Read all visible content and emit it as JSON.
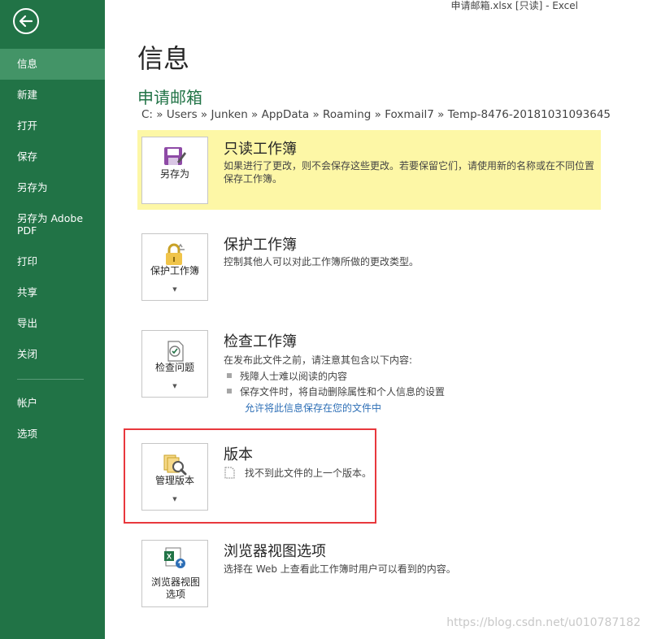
{
  "window": {
    "title": "申请邮箱.xlsx  [只读] - Excel"
  },
  "sidebar": {
    "items": [
      {
        "label": "信息",
        "active": true
      },
      {
        "label": "新建"
      },
      {
        "label": "打开"
      },
      {
        "label": "保存"
      },
      {
        "label": "另存为"
      },
      {
        "label": "另存为 Adobe PDF"
      },
      {
        "label": "打印"
      },
      {
        "label": "共享"
      },
      {
        "label": "导出"
      },
      {
        "label": "关闭"
      },
      {
        "label": "帐户"
      },
      {
        "label": "选项"
      }
    ]
  },
  "main": {
    "title": "信息",
    "document_name": "申请邮箱",
    "path": "C: » Users » Junken » AppData » Roaming » Foxmail7 » Temp-8476-20181031093645",
    "sections": {
      "readonly": {
        "button_label": "另存为",
        "title": "只读工作簿",
        "description": "如果进行了更改，则不会保存这些更改。若要保留它们，请使用新的名称或在不同位置保存工作簿。"
      },
      "protect": {
        "button_label": "保护工作簿",
        "title": "保护工作簿",
        "description": "控制其他人可以对此工作簿所做的更改类型。"
      },
      "inspect": {
        "button_label": "检查问题",
        "title": "检查工作簿",
        "description": "在发布此文件之前，请注意其包含以下内容:",
        "bullets": [
          "残障人士难以阅读的内容",
          "保存文件时，将自动删除属性和个人信息的设置"
        ],
        "link": "允许将此信息保存在您的文件中"
      },
      "versions": {
        "button_label": "管理版本",
        "title": "版本",
        "description": "找不到此文件的上一个版本。"
      },
      "browser": {
        "button_label": "浏览器视图选项",
        "title": "浏览器视图选项",
        "description": "选择在 Web 上查看此工作簿时用户可以看到的内容。"
      }
    }
  },
  "watermark": "https://blog.csdn.net/u010787182",
  "colors": {
    "sidebar": "#217346",
    "active": "#439467",
    "highlight": "#fdf7a6",
    "annotation": "#e8383d",
    "link": "#2e6fb6"
  }
}
